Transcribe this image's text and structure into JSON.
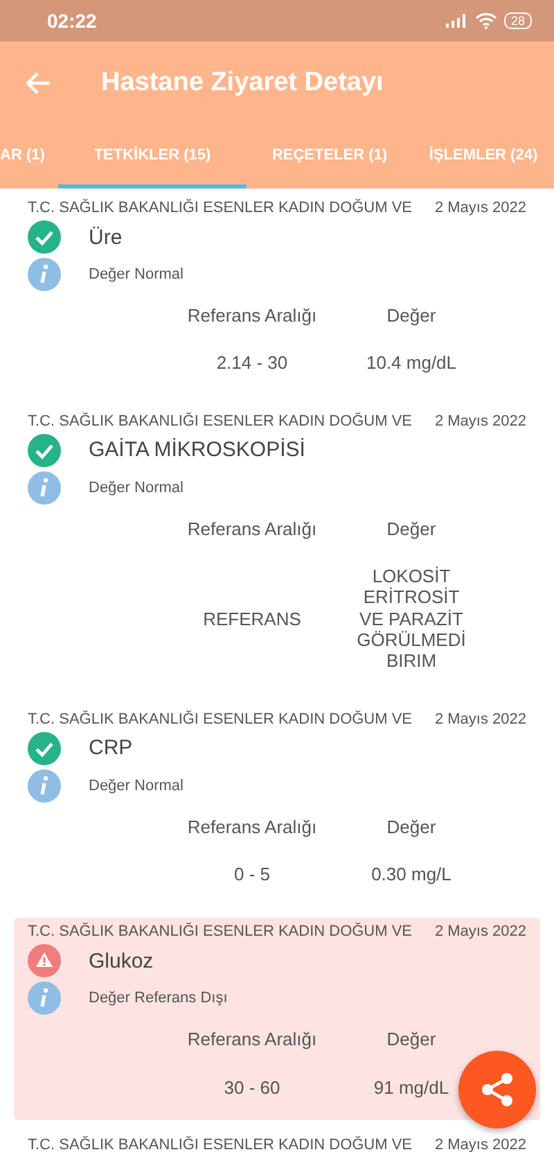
{
  "status_bar": {
    "time": "02:22",
    "battery": "28"
  },
  "app_bar": {
    "title": "Hastane Ziyaret Detayı"
  },
  "tabs": [
    {
      "label": "AR (1)",
      "selected": false
    },
    {
      "label": "TETKİKLER (15)",
      "selected": true
    },
    {
      "label": "REÇETELER (1)",
      "selected": false
    },
    {
      "label": "İŞLEMLER (24)",
      "selected": false
    }
  ],
  "results": [
    {
      "hospital": "T.C. SAĞLIK BAKANLIĞI ESENLER KADIN DOĞUM VE",
      "date": "2 Mayıs 2022",
      "test": "Üre",
      "kind": "normal",
      "note": "Değer Normal",
      "ref_label": "Referans Aralığı",
      "value_label": "Değer",
      "reference": "2.14 - 30",
      "value": "10.4 mg/dL"
    },
    {
      "hospital": "T.C. SAĞLIK BAKANLIĞI ESENLER KADIN DOĞUM VE",
      "date": "2 Mayıs 2022",
      "test": "GAİTA MİKROSKOPİSİ",
      "kind": "normal",
      "note": "Değer Normal",
      "ref_label": "Referans Aralığı",
      "value_label": "Değer",
      "reference": "REFERANS",
      "value": "LOKOSİT ERİTROSİT VE PARAZİT GÖRÜLMEDİ BIRIM"
    },
    {
      "hospital": "T.C. SAĞLIK BAKANLIĞI ESENLER KADIN DOĞUM VE",
      "date": "2 Mayıs 2022",
      "test": "CRP",
      "kind": "normal",
      "note": "Değer Normal",
      "ref_label": "Referans Aralığı",
      "value_label": "Değer",
      "reference": "0 - 5",
      "value": "0.30 mg/L"
    },
    {
      "hospital": "T.C. SAĞLIK BAKANLIĞI ESENLER KADIN DOĞUM VE",
      "date": "2 Mayıs 2022",
      "test": "Glukoz",
      "kind": "abnormal",
      "note": "Değer Referans Dışı",
      "ref_label": "Referans Aralığı",
      "value_label": "Değer",
      "reference": "30 - 60",
      "value": "91 mg/dL"
    },
    {
      "hospital": "T.C. SAĞLIK BAKANLIĞI ESENLER KADIN DOĞUM VE",
      "date": "2 Mayıs 2022"
    }
  ]
}
